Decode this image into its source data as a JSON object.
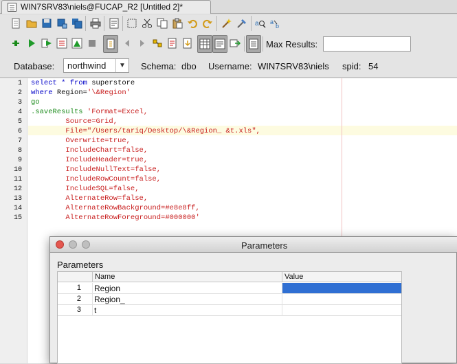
{
  "tab": {
    "title": "WIN7SRV83\\niels@FUCAP_R2 [Untitled 2]*"
  },
  "toolbar1": {
    "icons": [
      "new-file-icon",
      "open-folder-icon",
      "save-icon",
      "save-as-icon",
      "save-all-icon",
      "print-icon",
      "properties-icon",
      "select-icon",
      "cut-icon",
      "copy-icon",
      "paste-icon",
      "undo-icon",
      "redo-icon",
      "wand-icon",
      "format-icon",
      "find-icon",
      "replace-icon"
    ]
  },
  "toolbar2": {
    "icons": [
      "connect-icon",
      "run-icon",
      "run-selection-icon",
      "explain-icon",
      "stop-icon",
      "commit-toggle-icon",
      "back-icon",
      "forward-icon",
      "chain-icon",
      "script-icon",
      "grid-results-icon",
      "text-results-icon",
      "export-icon",
      "history-icon"
    ],
    "max_results_label": "Max Results:",
    "max_results_value": ""
  },
  "connection": {
    "database_label": "Database:",
    "database_value": "northwind",
    "schema_label": "Schema:",
    "schema_value": "dbo",
    "username_label": "Username:",
    "username_value": "WIN7SRV83\\niels",
    "spid_label": "spid:",
    "spid_value": "54"
  },
  "editor": {
    "line_numbers": [
      "1",
      "2",
      "3",
      "4",
      "5",
      "6",
      "7",
      "8",
      "9",
      "10",
      "11",
      "12",
      "13",
      "14",
      "15"
    ],
    "lines": {
      "l1a": "select * from",
      "l1b": " superstore",
      "l2a": "where",
      "l2b": " Region=",
      "l2c": "'\\&Region'",
      "l3": "go",
      "l4a": ".saveResults",
      "l4b": " 'Format=Excel,",
      "l5": "        Source=Grid,",
      "l6": "        File=\"/Users/tariq/Desktop/\\&Region_ &t.xls\",",
      "l7": "        Overwrite=true,",
      "l8": "        IncludeChart=false,",
      "l9": "        IncludeHeader=true,",
      "l10": "        IncludeNullText=false,",
      "l11": "        IncludeRowCount=false,",
      "l12": "        IncludeSQL=false,",
      "l13": "        AlternateRow=false,",
      "l14": "        AlternateRowBackground=#e8e8ff,",
      "l15": "        AlternateRowForeground=#000000'"
    }
  },
  "dialog": {
    "title": "Parameters",
    "heading": "Parameters",
    "columns": {
      "name": "Name",
      "value": "Value"
    },
    "rows": [
      {
        "num": "1",
        "name": "Region",
        "value": ""
      },
      {
        "num": "2",
        "name": "Region_",
        "value": ""
      },
      {
        "num": "3",
        "name": "t",
        "value": ""
      }
    ]
  }
}
